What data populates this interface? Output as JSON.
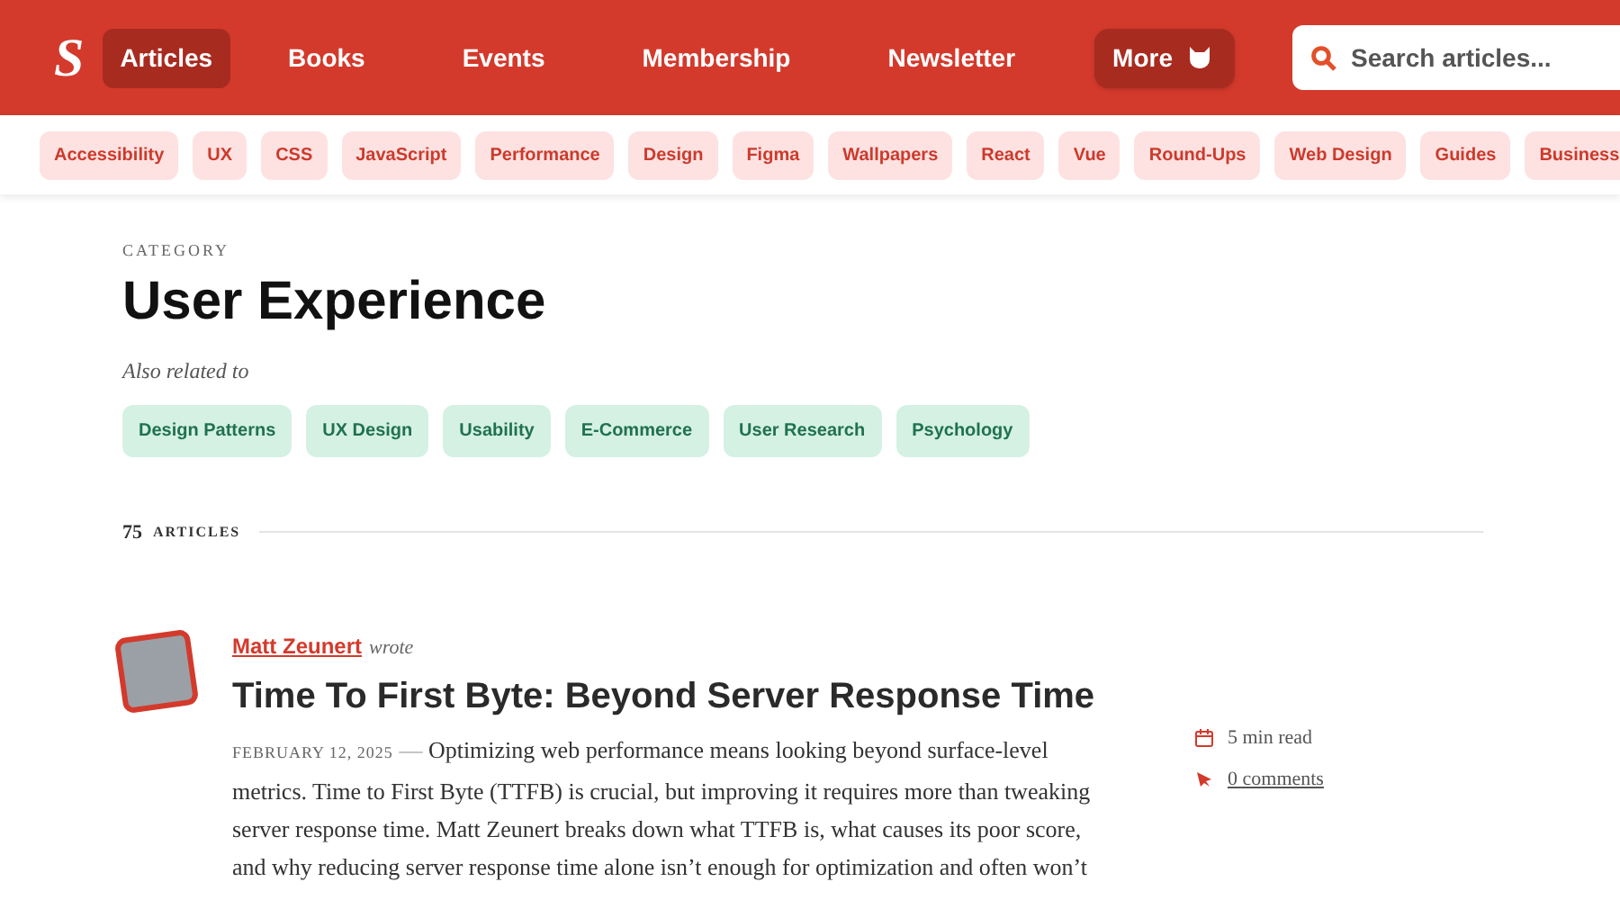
{
  "header": {
    "logo": "S",
    "nav": [
      {
        "label": "Articles",
        "selected": true
      },
      {
        "label": "Books",
        "selected": false
      },
      {
        "label": "Events",
        "selected": false
      },
      {
        "label": "Membership",
        "selected": false
      },
      {
        "label": "Newsletter",
        "selected": false
      }
    ],
    "more": "More",
    "search": {
      "placeholder": "Search articles..."
    }
  },
  "topics": [
    "Accessibility",
    "UX",
    "CSS",
    "JavaScript",
    "Performance",
    "Design",
    "Figma",
    "Wallpapers",
    "React",
    "Vue",
    "Round-Ups",
    "Web Design",
    "Guides",
    "Business"
  ],
  "category": {
    "eyebrow": "CATEGORY",
    "title": "User Experience",
    "related_label": "Also related to",
    "related": [
      "Design Patterns",
      "UX Design",
      "Usability",
      "E-Commerce",
      "User Research",
      "Psychology"
    ]
  },
  "count": {
    "number": "75",
    "label": "ARTICLES"
  },
  "article": {
    "author": "Matt Zeunert",
    "wrote": "wrote",
    "title": "Time To First Byte: Beyond Server Response Time",
    "date": "FEBRUARY 12, 2025",
    "separator": "—",
    "excerpt": "Optimizing web performance means looking beyond surface-level metrics. Time to First Byte (TTFB) is crucial, but improving it requires more than tweaking server response time. Matt Zeunert breaks down what TTFB is, what causes its poor score, and why reducing server response time alone isn’t enough for optimization and often won’t",
    "read_time": "5 min read",
    "comments": "0 comments"
  }
}
